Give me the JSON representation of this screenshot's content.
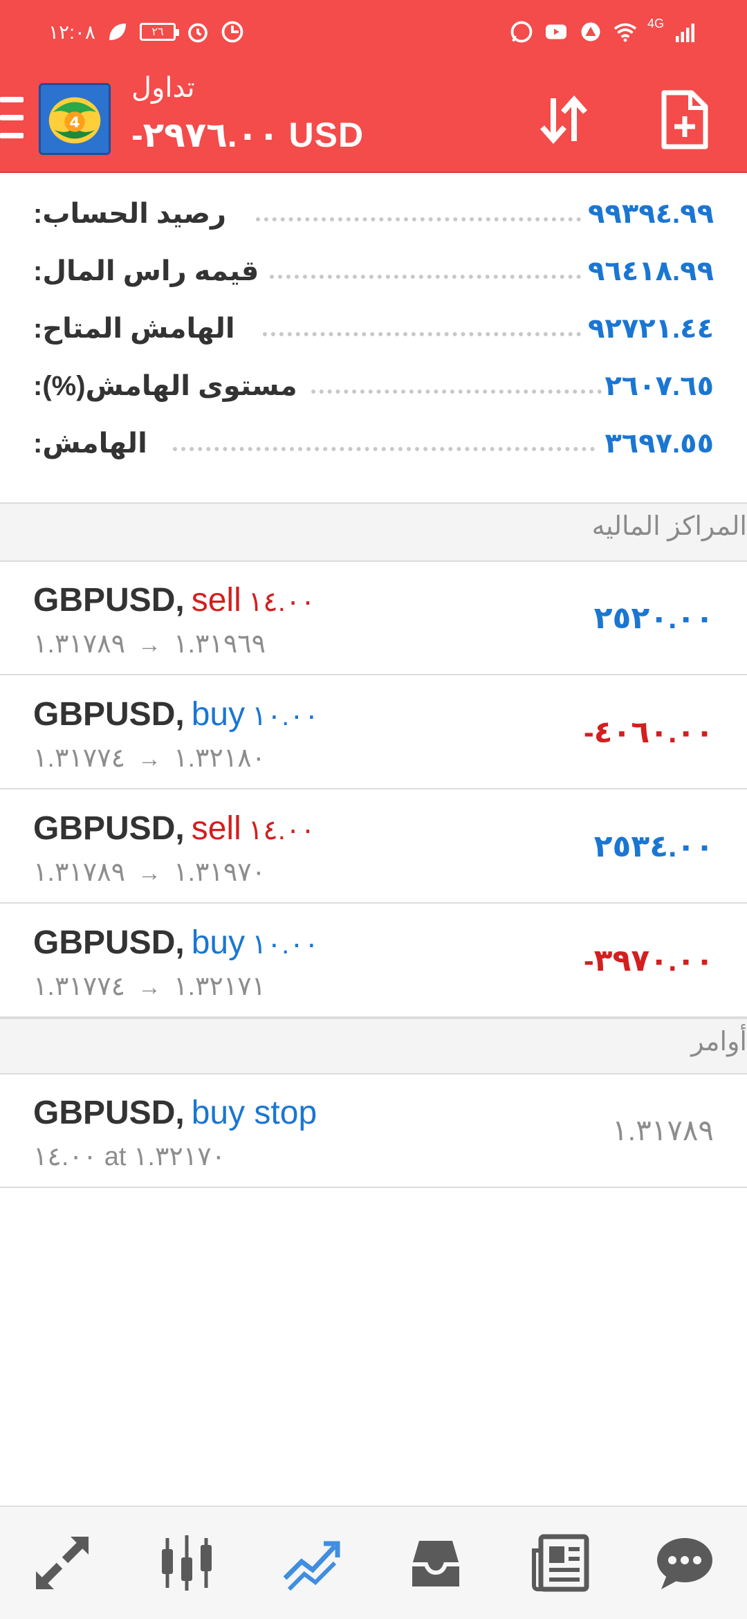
{
  "status_bar": {
    "time": "١٢:٠٨",
    "battery": "٢٦",
    "network": "4G"
  },
  "app_bar": {
    "title": "تداول",
    "subtitle": "-٢٩٧٦.٠٠ USD",
    "sort_icon": "sort-arrows-icon",
    "new_order_icon": "new-document-icon"
  },
  "summary": [
    {
      "label": "رصيد الحساب:",
      "value": "٩٩٣٩٤.٩٩"
    },
    {
      "label": "قيمه راس المال:",
      "value": "٩٦٤١٨.٩٩"
    },
    {
      "label": "الهامش المتاح:",
      "value": "٩٢٧٢١.٤٤"
    },
    {
      "label": "مستوى الهامش(%):",
      "value": "٢٦٠٧.٦٥"
    },
    {
      "label": "الهامش:",
      "value": "٣٦٩٧.٥٥"
    }
  ],
  "positions_title": "المراكز الماليه",
  "positions": [
    {
      "symbol": "GBPUSD,",
      "side": "sell",
      "volume": "١٤.٠٠",
      "open": "١.٣١٧٨٩",
      "arrow": "→",
      "current": "١.٣١٩٦٩",
      "profit": "٢٥٢٠.٠٠",
      "profit_sign": "positive"
    },
    {
      "symbol": "GBPUSD,",
      "side": "buy",
      "volume": "١٠.٠٠",
      "open": "١.٣١٧٧٤",
      "arrow": "→",
      "current": "١.٣٢١٨٠",
      "profit": "-٤٠٦٠.٠٠",
      "profit_sign": "negative"
    },
    {
      "symbol": "GBPUSD,",
      "side": "sell",
      "volume": "١٤.٠٠",
      "open": "١.٣١٧٨٩",
      "arrow": "→",
      "current": "١.٣١٩٧٠",
      "profit": "٢٥٣٤.٠٠",
      "profit_sign": "positive"
    },
    {
      "symbol": "GBPUSD,",
      "side": "buy",
      "volume": "١٠.٠٠",
      "open": "١.٣١٧٧٤",
      "arrow": "→",
      "current": "١.٣٢١٧١",
      "profit": "-٣٩٧٠.٠٠",
      "profit_sign": "negative"
    }
  ],
  "orders_title": "أوامر",
  "orders": [
    {
      "symbol": "GBPUSD,",
      "type": "buy stop",
      "detail": "١٤.٠٠ at ١.٣٢١٧٠",
      "price": "١.٣١٧٨٩"
    }
  ],
  "bottom_nav": [
    {
      "icon": "quotes-arrows-icon",
      "active": false
    },
    {
      "icon": "chart-candles-icon",
      "active": false
    },
    {
      "icon": "trade-trend-icon",
      "active": true
    },
    {
      "icon": "history-inbox-icon",
      "active": false
    },
    {
      "icon": "news-icon",
      "active": false
    },
    {
      "icon": "chat-icon",
      "active": false
    }
  ],
  "colors": {
    "accent_red": "#f44b4b",
    "value_blue": "#1a76d2",
    "loss_red": "#d21f1f",
    "nav_active": "#3f8ee0",
    "nav_inactive": "#5a5a5a"
  }
}
